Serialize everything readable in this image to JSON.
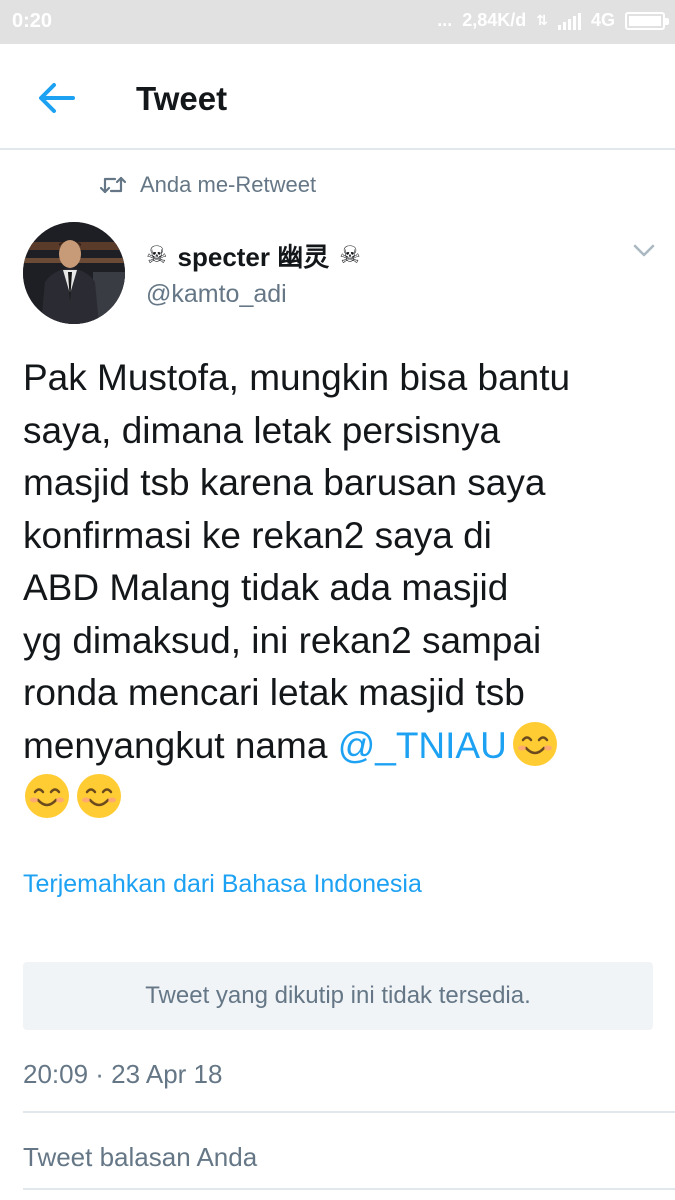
{
  "status_bar": {
    "time": "0:20",
    "dots": "...",
    "network_speed": "2,84K/d",
    "network_type": "4G",
    "battery_level": 1.0
  },
  "app_bar": {
    "title": "Tweet",
    "back_icon": "arrow-left-icon"
  },
  "retweet_context": {
    "icon": "retweet-icon",
    "text": "Anda me-Retweet"
  },
  "tweet": {
    "author": {
      "display_name": "specter 幽灵",
      "name_decorations": [
        "skull-crossbones-icon",
        "skull-crossbones-icon"
      ],
      "handle": "@kamto_adi"
    },
    "text_lines": [
      "Pak Mustofa, mungkin bisa bantu",
      "saya, dimana letak persisnya",
      "masjid tsb karena barusan saya",
      "konfirmasi ke rekan2 saya di",
      "ABD Malang tidak ada masjid",
      "yg dimaksud, ini rekan2 sampai",
      "ronda mencari letak masjid tsb",
      "menyangkut nama "
    ],
    "mention": "@_TNIAU",
    "emoji": "smiling-face-icon",
    "translate_link": "Terjemahkan dari Bahasa Indonesia",
    "quoted_unavailable": "Tweet yang dikutip ini tidak tersedia.",
    "timestamp": "20:09 · 23 Apr 18"
  },
  "reply": {
    "placeholder": "Tweet balasan Anda"
  },
  "colors": {
    "link": "#1da1f2",
    "secondary_text": "#657786",
    "primary_text": "#14171a",
    "status_bar_bg": "#e1e1e1",
    "quote_bg": "#f1f4f7"
  }
}
